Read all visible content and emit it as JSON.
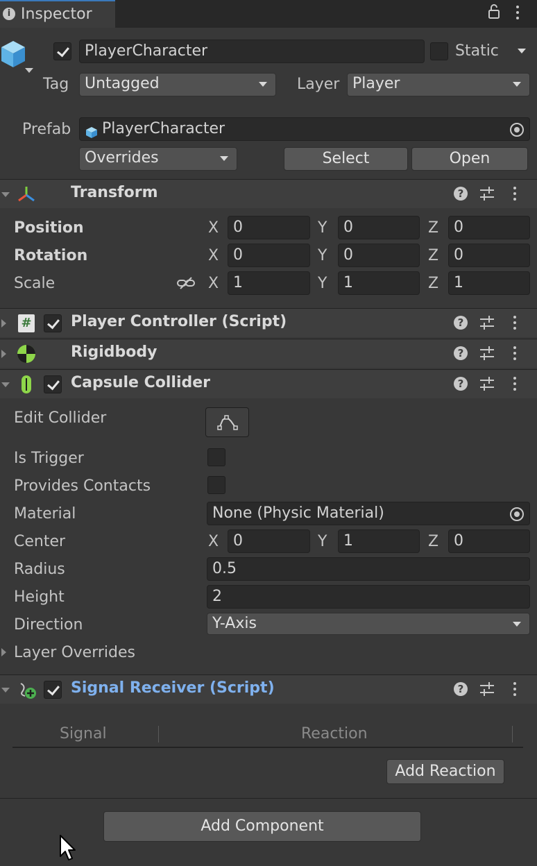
{
  "tab": {
    "title": "Inspector"
  },
  "gameobject": {
    "name": "PlayerCharacter",
    "active": true,
    "static_label": "Static",
    "tag_label": "Tag",
    "tag_value": "Untagged",
    "layer_label": "Layer",
    "layer_value": "Player"
  },
  "prefab": {
    "label": "Prefab",
    "value": "PlayerCharacter",
    "overrides_label": "Overrides",
    "select_label": "Select",
    "open_label": "Open"
  },
  "transform": {
    "title": "Transform",
    "position_label": "Position",
    "rotation_label": "Rotation",
    "scale_label": "Scale",
    "axis_x": "X",
    "axis_y": "Y",
    "axis_z": "Z",
    "position": {
      "x": "0",
      "y": "0",
      "z": "0"
    },
    "rotation": {
      "x": "0",
      "y": "0",
      "z": "0"
    },
    "scale": {
      "x": "1",
      "y": "1",
      "z": "1"
    }
  },
  "components": {
    "player_controller": {
      "title": "Player Controller (Script)",
      "enabled": true
    },
    "rigidbody": {
      "title": "Rigidbody"
    },
    "capsule_collider": {
      "title": "Capsule Collider",
      "enabled": true,
      "edit_collider_label": "Edit Collider",
      "is_trigger_label": "Is Trigger",
      "provides_contacts_label": "Provides Contacts",
      "material_label": "Material",
      "material_value": "None (Physic Material)",
      "center_label": "Center",
      "center": {
        "x": "0",
        "y": "1",
        "z": "0"
      },
      "radius_label": "Radius",
      "radius": "0.5",
      "height_label": "Height",
      "height": "2",
      "direction_label": "Direction",
      "direction": "Y-Axis",
      "layer_overrides_label": "Layer Overrides"
    },
    "signal_receiver": {
      "title": "Signal Receiver (Script)",
      "enabled": true,
      "col_signal": "Signal",
      "col_reaction": "Reaction",
      "add_reaction_label": "Add Reaction"
    }
  },
  "add_component_label": "Add Component",
  "colors": {
    "background": "#383838",
    "header": "#3e3e3e",
    "field": "#2a2a2a",
    "link_blue": "#7fb1ee"
  }
}
